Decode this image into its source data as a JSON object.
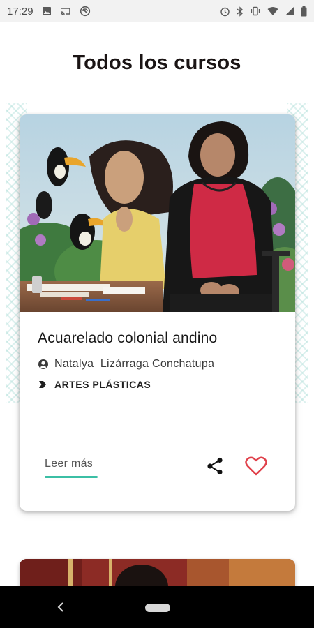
{
  "status_bar": {
    "time": "17:29"
  },
  "page": {
    "title": "Todos los cursos"
  },
  "course_card": {
    "title": "Acuarelado colonial andino",
    "author": "Natalya  Lizárraga Conchatupa",
    "category": "ARTES PLÁSTICAS",
    "read_more_label": "Leer más"
  },
  "colors": {
    "accent": "#3bbfa5",
    "favorite": "#e0404a",
    "title": "#1a1414"
  },
  "icons": [
    "image-icon",
    "cast-icon",
    "sync-icon",
    "alarm-icon",
    "bluetooth-icon",
    "vibrate-icon",
    "wifi-icon",
    "signal-icon",
    "battery-icon",
    "user-icon",
    "tag-icon",
    "share-icon",
    "heart-icon",
    "back-icon",
    "home-pill"
  ]
}
